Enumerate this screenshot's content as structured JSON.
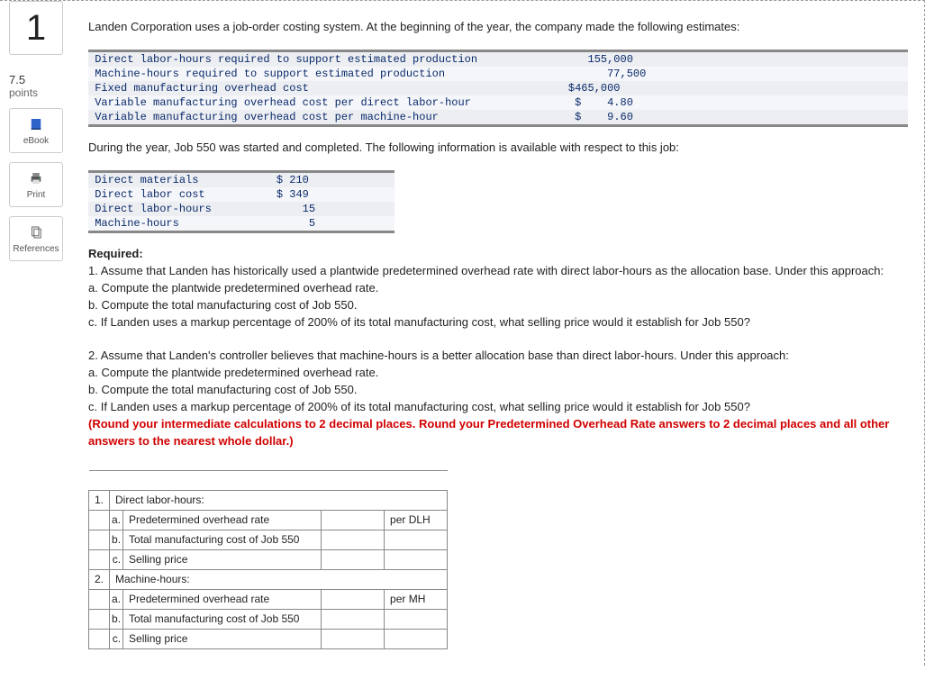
{
  "question_number": "1",
  "points_value": "7.5",
  "points_label": "points",
  "tools": {
    "ebook": "eBook",
    "print": "Print",
    "references": "References"
  },
  "intro1": "Landen Corporation uses a job-order costing system. At the beginning of the year, the company made the following estimates:",
  "estimates": {
    "r1_label": "Direct labor-hours required to support estimated production",
    "r1_val": "155,000",
    "r2_label": "Machine-hours required to support estimated production",
    "r2_val": "77,500",
    "r3_label": "Fixed manufacturing overhead cost",
    "r3_val": "$465,000",
    "r4_label": "Variable manufacturing overhead cost per direct labor-hour",
    "r4_cur": "$",
    "r4_val": "4.80",
    "r5_label": "Variable manufacturing overhead cost per machine-hour",
    "r5_cur": "$",
    "r5_val": "9.60"
  },
  "intro2": "During the year, Job 550 was started and completed. The following information is available with respect to this job:",
  "job": {
    "r1_label": "Direct materials",
    "r1_cur": "$",
    "r1_val": "210",
    "r2_label": "Direct labor cost",
    "r2_cur": "$",
    "r2_val": "349",
    "r3_label": "Direct labor-hours",
    "r3_val": "15",
    "r4_label": "Machine-hours",
    "r4_val": "5"
  },
  "required": {
    "heading": "Required:",
    "p1": "1. Assume that Landen has historically used a plantwide predetermined overhead rate with direct labor-hours as the allocation base. Under this approach:",
    "p1a": "a. Compute the plantwide predetermined overhead rate.",
    "p1b": "b. Compute the total manufacturing cost of Job 550.",
    "p1c": "c. If Landen uses a markup percentage of 200% of its total manufacturing cost, what selling price would it establish for Job 550?",
    "p2": "2. Assume that Landen's controller believes that machine-hours is a better allocation base than direct labor-hours. Under this approach:",
    "p2a": "a. Compute the plantwide predetermined overhead rate.",
    "p2b": "b. Compute the total manufacturing cost of Job 550.",
    "p2c": "c. If Landen uses a markup percentage of 200% of its total manufacturing cost, what selling price would it establish for Job 550?",
    "note": "(Round your intermediate calculations to 2 decimal places. Round your Predetermined Overhead Rate answers to 2 decimal places and all other answers to the nearest whole dollar.)"
  },
  "answers": {
    "sec1_num": "1.",
    "sec1_title": "Direct labor-hours:",
    "sec2_num": "2.",
    "sec2_title": "Machine-hours:",
    "a_letter": "a.",
    "b_letter": "b.",
    "c_letter": "c.",
    "row_a": "Predetermined overhead rate",
    "row_b": "Total manufacturing cost of Job 550",
    "row_c": "Selling price",
    "unit_dlh": "per DLH",
    "unit_mh": "per MH"
  }
}
